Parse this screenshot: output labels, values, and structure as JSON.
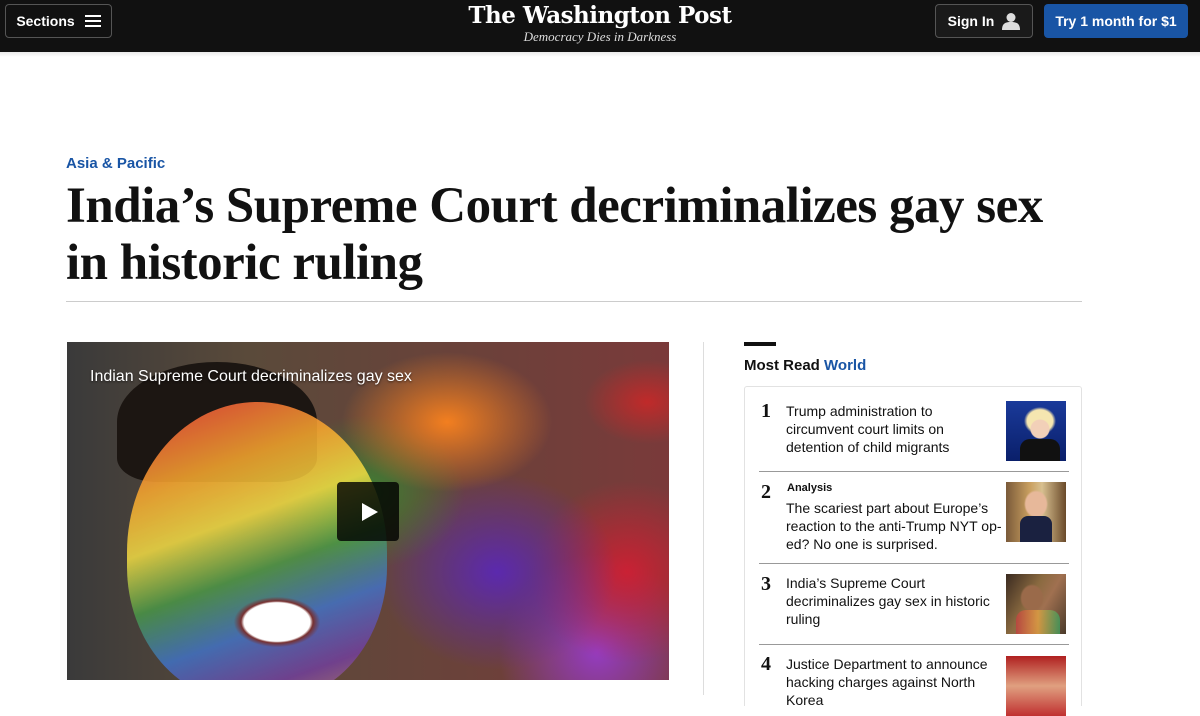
{
  "nav": {
    "sections_label": "Sections",
    "logo": "The Washington Post",
    "tagline": "Democracy Dies in Darkness",
    "signin_label": "Sign In",
    "subscribe_label": "Try 1 month for $1"
  },
  "article": {
    "kicker": "Asia & Pacific",
    "headline": "India’s Supreme Court decriminalizes gay sex in historic ruling"
  },
  "video": {
    "title": "Indian Supreme Court decriminalizes gay sex"
  },
  "most_read": {
    "heading_prefix": "Most Read",
    "heading_section": "World",
    "items": [
      {
        "number": "1",
        "label": "",
        "title": "Trump administration to circumvent court limits on detention of child migrants"
      },
      {
        "number": "2",
        "label": "Analysis",
        "title": "The scariest part about Europe’s reaction to the anti-Trump NYT op-ed? No one is surprised."
      },
      {
        "number": "3",
        "label": "",
        "title": "India’s Supreme Court decriminalizes gay sex in historic ruling"
      },
      {
        "number": "4",
        "label": "",
        "title": "Justice Department to announce hacking charges against North Korea"
      }
    ]
  },
  "colors": {
    "accent": "#1955a5",
    "topbar": "#111111"
  }
}
